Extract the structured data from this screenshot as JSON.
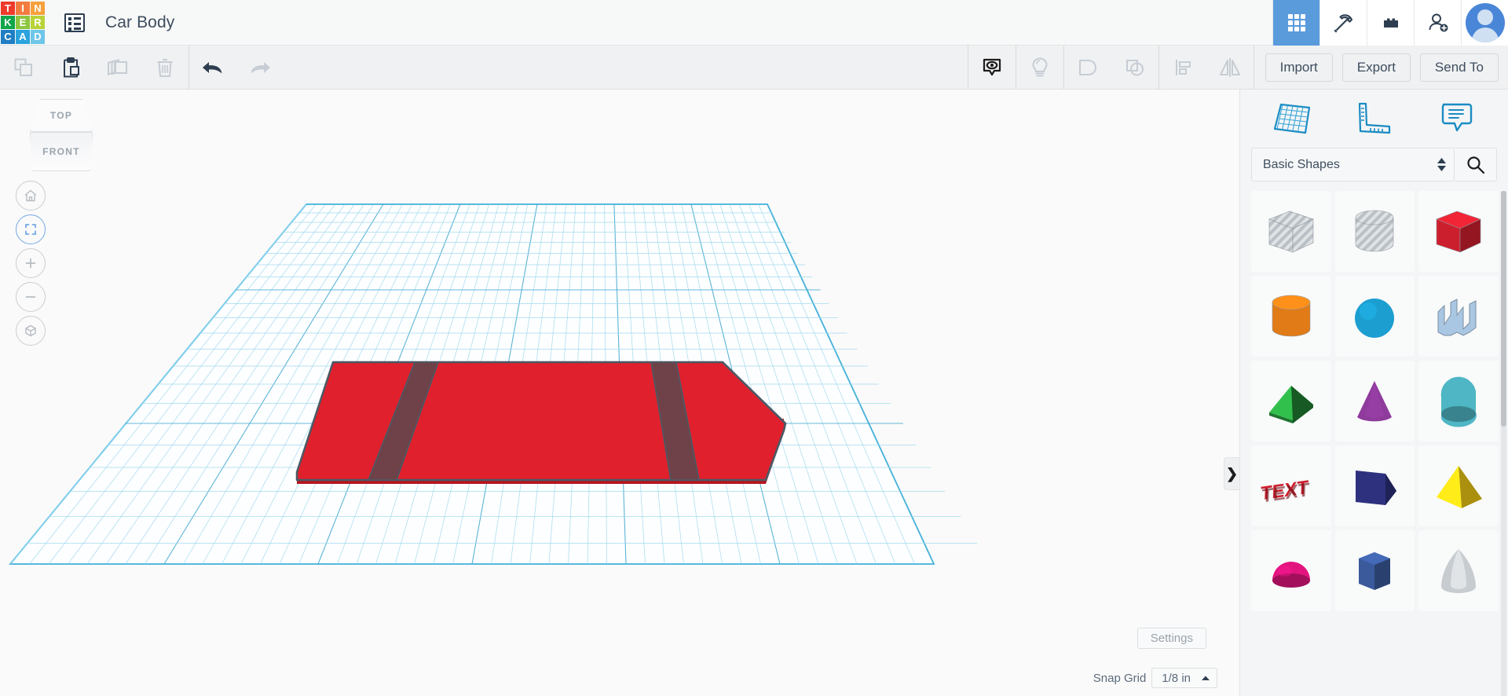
{
  "app": {
    "logo_letters": [
      "T",
      "I",
      "N",
      "K",
      "E",
      "R",
      "C",
      "A",
      "D"
    ],
    "logo_colors": [
      "#ee3a2b",
      "#f47b3f",
      "#f6a13c",
      "#10a64a",
      "#8cc63f",
      "#b8d33a",
      "#1f7ec4",
      "#2ba3dd",
      "#6ec6e8"
    ],
    "doc_icon_name": "project-list-icon",
    "title": "Car Body"
  },
  "topbar": {
    "buttons": [
      {
        "name": "grid-apps-icon",
        "label": "Apps",
        "active": true
      },
      {
        "name": "pickaxe-icon",
        "label": "Minecraft",
        "active": false
      },
      {
        "name": "brick-icon",
        "label": "Blocks",
        "active": false
      },
      {
        "name": "add-person-icon",
        "label": "Invite",
        "active": false
      }
    ],
    "avatar_label": "Account"
  },
  "toolbar": {
    "left_tools": [
      {
        "name": "copy-icon",
        "label": "Copy",
        "enabled": false
      },
      {
        "name": "paste-icon",
        "label": "Paste",
        "enabled": true
      },
      {
        "name": "duplicate-icon",
        "label": "Duplicate",
        "enabled": false
      },
      {
        "name": "trash-icon",
        "label": "Delete",
        "enabled": false
      }
    ],
    "history_tools": [
      {
        "name": "undo-icon",
        "label": "Undo",
        "enabled": true
      },
      {
        "name": "redo-icon",
        "label": "Redo",
        "enabled": false
      }
    ],
    "right_tools": [
      {
        "name": "visibility-eye-icon",
        "label": "Show all",
        "enabled": true
      },
      {
        "name": "lightbulb-icon",
        "label": "Hide",
        "enabled": false
      },
      {
        "name": "group-icon",
        "label": "Group",
        "enabled": false
      },
      {
        "name": "ungroup-icon",
        "label": "Ungroup",
        "enabled": false
      },
      {
        "name": "align-icon",
        "label": "Align",
        "enabled": false
      },
      {
        "name": "mirror-icon",
        "label": "Mirror",
        "enabled": false
      }
    ],
    "import_label": "Import",
    "export_label": "Export",
    "sendto_label": "Send To"
  },
  "canvas": {
    "viewcube": {
      "top_face": "TOP",
      "front_face": "FRONT"
    },
    "nav_buttons": [
      {
        "name": "home-view-icon",
        "label": "Home view",
        "selected": false
      },
      {
        "name": "fit-to-view-icon",
        "label": "Fit all in view",
        "selected": true
      },
      {
        "name": "zoom-in-icon",
        "label": "Zoom in",
        "selected": false
      },
      {
        "name": "zoom-out-icon",
        "label": "Zoom out",
        "selected": false
      },
      {
        "name": "perspective-cube-icon",
        "label": "Switch to orthographic",
        "selected": false
      }
    ],
    "settings_label": "Settings",
    "snap_grid_label": "Snap Grid",
    "snap_grid_value": "1/8 in",
    "collapse_tab_glyph": "❯",
    "model": {
      "name": "car-body-slab",
      "body_color": "#e0202c",
      "hole_color": "#6e4248",
      "edge_color": "#4b5a66"
    },
    "grid_color": "#67c5e8",
    "grid_major_color": "#3fa8d0"
  },
  "panel": {
    "tabs": [
      {
        "name": "workplane-icon",
        "label": "Workplane"
      },
      {
        "name": "ruler-icon",
        "label": "Ruler"
      },
      {
        "name": "note-icon",
        "label": "Note"
      }
    ],
    "category_value": "Basic Shapes",
    "search_icon_name": "search-icon",
    "shapes": [
      {
        "name": "box-hole",
        "label": "Box (Hole)",
        "color": "#c9ced3",
        "kind": "box-striped"
      },
      {
        "name": "cylinder-hole",
        "label": "Cylinder (Hole)",
        "color": "#c9ced3",
        "kind": "cyl-striped"
      },
      {
        "name": "box-red",
        "label": "Box",
        "color": "#cc1f2e",
        "kind": "box"
      },
      {
        "name": "cylinder-orange",
        "label": "Cylinder",
        "color": "#e07b17",
        "kind": "cyl"
      },
      {
        "name": "sphere-blue",
        "label": "Sphere",
        "color": "#1c9ed0",
        "kind": "sphere"
      },
      {
        "name": "scribble",
        "label": "Scribble",
        "color": "#a9c6e2",
        "kind": "scribble"
      },
      {
        "name": "roof-green",
        "label": "Roof",
        "color": "#2aa341",
        "kind": "roof"
      },
      {
        "name": "cone-purple",
        "label": "Cone",
        "color": "#8e3b9c",
        "kind": "cone"
      },
      {
        "name": "round-roof-teal",
        "label": "Round Roof",
        "color": "#4eb6c4",
        "kind": "roundroof"
      },
      {
        "name": "text-red",
        "label": "Text",
        "color": "#cc1f2e",
        "kind": "text"
      },
      {
        "name": "wedge-navy",
        "label": "Wedge",
        "color": "#2b2f77",
        "kind": "wedge"
      },
      {
        "name": "pyramid-yellow",
        "label": "Pyramid",
        "color": "#ecc814",
        "kind": "pyramid"
      },
      {
        "name": "half-sphere-pink",
        "label": "Half Sphere",
        "color": "#e2157f",
        "kind": "halfsphere"
      },
      {
        "name": "hex-prism-blue",
        "label": "Hexagonal Prism",
        "color": "#3a5a9c",
        "kind": "hex"
      },
      {
        "name": "paraboloid-gray",
        "label": "Paraboloid",
        "color": "#c7ccd1",
        "kind": "paraboloid"
      }
    ]
  }
}
